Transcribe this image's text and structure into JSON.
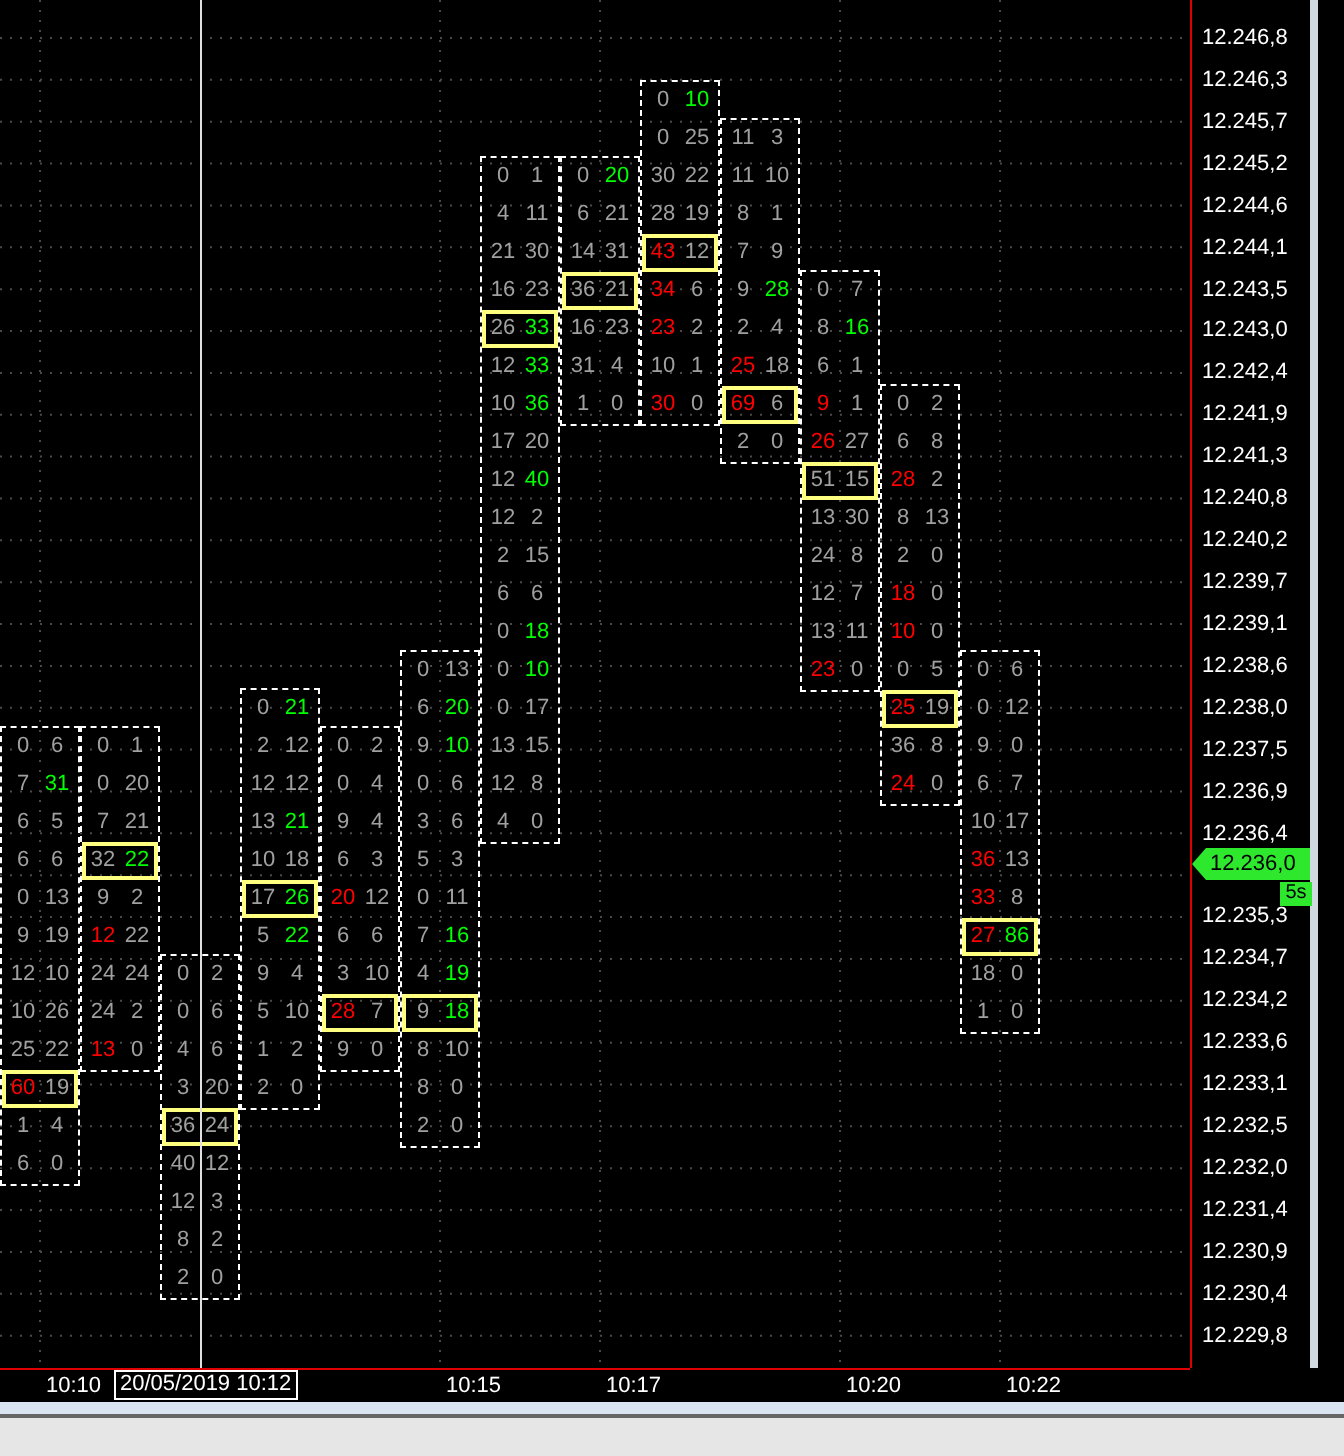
{
  "chart": {
    "columns": [
      {
        "rows": [
          {
            "bid": {
              "text": "0",
              "color": "#a0a0a0"
            },
            "ask": {
              "text": "6",
              "color": "#a0a0a0"
            },
            "poc": false
          },
          {
            "bid": {
              "text": "7",
              "color": "#a0a0a0"
            },
            "ask": {
              "text": "31",
              "color": "#00ff00"
            },
            "poc": false
          },
          {
            "bid": {
              "text": "6",
              "color": "#a0a0a0"
            },
            "ask": {
              "text": "5",
              "color": "#a0a0a0"
            },
            "poc": false
          },
          {
            "bid": {
              "text": "6",
              "color": "#a0a0a0"
            },
            "ask": {
              "text": "6",
              "color": "#a0a0a0"
            },
            "poc": false
          },
          {
            "bid": {
              "text": "0",
              "color": "#a0a0a0"
            },
            "ask": {
              "text": "13",
              "color": "#a0a0a0"
            },
            "poc": false
          },
          {
            "bid": {
              "text": "9",
              "color": "#a0a0a0"
            },
            "ask": {
              "text": "19",
              "color": "#a0a0a0"
            },
            "poc": false
          },
          {
            "bid": {
              "text": "12",
              "color": "#a0a0a0"
            },
            "ask": {
              "text": "10",
              "color": "#a0a0a0"
            },
            "poc": false
          },
          {
            "bid": {
              "text": "10",
              "color": "#a0a0a0"
            },
            "ask": {
              "text": "26",
              "color": "#a0a0a0"
            },
            "poc": false
          },
          {
            "bid": {
              "text": "25",
              "color": "#a0a0a0"
            },
            "ask": {
              "text": "22",
              "color": "#a0a0a0"
            },
            "poc": false
          },
          {
            "bid": {
              "text": "60",
              "color": "#ff0000"
            },
            "ask": {
              "text": "19",
              "color": "#a0a0a0"
            },
            "poc": true
          },
          {
            "bid": {
              "text": "1",
              "color": "#a0a0a0"
            },
            "ask": {
              "text": "4",
              "color": "#a0a0a0"
            },
            "poc": false
          },
          {
            "bid": {
              "text": "6",
              "color": "#a0a0a0"
            },
            "ask": {
              "text": "0",
              "color": "#a0a0a0"
            },
            "poc": false
          }
        ]
      },
      {
        "rows": [
          {
            "bid": {
              "text": "0",
              "color": "#a0a0a0"
            },
            "ask": {
              "text": "1",
              "color": "#a0a0a0"
            },
            "poc": false
          },
          {
            "bid": {
              "text": "0",
              "color": "#a0a0a0"
            },
            "ask": {
              "text": "20",
              "color": "#a0a0a0"
            },
            "poc": false
          },
          {
            "bid": {
              "text": "7",
              "color": "#a0a0a0"
            },
            "ask": {
              "text": "21",
              "color": "#a0a0a0"
            },
            "poc": false
          },
          {
            "bid": {
              "text": "32",
              "color": "#a0a0a0"
            },
            "ask": {
              "text": "22",
              "color": "#00ff00"
            },
            "poc": true
          },
          {
            "bid": {
              "text": "9",
              "color": "#a0a0a0"
            },
            "ask": {
              "text": "2",
              "color": "#a0a0a0"
            },
            "poc": false
          },
          {
            "bid": {
              "text": "12",
              "color": "#ff0000"
            },
            "ask": {
              "text": "22",
              "color": "#a0a0a0"
            },
            "poc": false
          },
          {
            "bid": {
              "text": "24",
              "color": "#a0a0a0"
            },
            "ask": {
              "text": "24",
              "color": "#a0a0a0"
            },
            "poc": false
          },
          {
            "bid": {
              "text": "24",
              "color": "#a0a0a0"
            },
            "ask": {
              "text": "2",
              "color": "#a0a0a0"
            },
            "poc": false
          },
          {
            "bid": {
              "text": "13",
              "color": "#ff0000"
            },
            "ask": {
              "text": "0",
              "color": "#a0a0a0"
            },
            "poc": false
          }
        ]
      },
      {
        "rows": [
          {
            "bid": {
              "text": "0",
              "color": "#a0a0a0"
            },
            "ask": {
              "text": "2",
              "color": "#a0a0a0"
            },
            "poc": false
          },
          {
            "bid": {
              "text": "0",
              "color": "#a0a0a0"
            },
            "ask": {
              "text": "6",
              "color": "#a0a0a0"
            },
            "poc": false
          },
          {
            "bid": {
              "text": "4",
              "color": "#a0a0a0"
            },
            "ask": {
              "text": "6",
              "color": "#a0a0a0"
            },
            "poc": false
          },
          {
            "bid": {
              "text": "3",
              "color": "#a0a0a0"
            },
            "ask": {
              "text": "20",
              "color": "#a0a0a0"
            },
            "poc": false
          },
          {
            "bid": {
              "text": "36",
              "color": "#a0a0a0"
            },
            "ask": {
              "text": "24",
              "color": "#a0a0a0"
            },
            "poc": true
          },
          {
            "bid": {
              "text": "40",
              "color": "#a0a0a0"
            },
            "ask": {
              "text": "12",
              "color": "#a0a0a0"
            },
            "poc": false
          },
          {
            "bid": {
              "text": "12",
              "color": "#a0a0a0"
            },
            "ask": {
              "text": "3",
              "color": "#a0a0a0"
            },
            "poc": false
          },
          {
            "bid": {
              "text": "8",
              "color": "#a0a0a0"
            },
            "ask": {
              "text": "2",
              "color": "#a0a0a0"
            },
            "poc": false
          },
          {
            "bid": {
              "text": "2",
              "color": "#a0a0a0"
            },
            "ask": {
              "text": "0",
              "color": "#a0a0a0"
            },
            "poc": false
          }
        ]
      },
      {
        "rows": [
          {
            "bid": {
              "text": "0",
              "color": "#a0a0a0"
            },
            "ask": {
              "text": "21",
              "color": "#00ff00"
            },
            "poc": false
          },
          {
            "bid": {
              "text": "2",
              "color": "#a0a0a0"
            },
            "ask": {
              "text": "12",
              "color": "#a0a0a0"
            },
            "poc": false
          },
          {
            "bid": {
              "text": "12",
              "color": "#a0a0a0"
            },
            "ask": {
              "text": "12",
              "color": "#a0a0a0"
            },
            "poc": false
          },
          {
            "bid": {
              "text": "13",
              "color": "#a0a0a0"
            },
            "ask": {
              "text": "21",
              "color": "#00ff00"
            },
            "poc": false
          },
          {
            "bid": {
              "text": "10",
              "color": "#a0a0a0"
            },
            "ask": {
              "text": "18",
              "color": "#a0a0a0"
            },
            "poc": false
          },
          {
            "bid": {
              "text": "17",
              "color": "#a0a0a0"
            },
            "ask": {
              "text": "26",
              "color": "#00ff00"
            },
            "poc": true
          },
          {
            "bid": {
              "text": "5",
              "color": "#a0a0a0"
            },
            "ask": {
              "text": "22",
              "color": "#00ff00"
            },
            "poc": false
          },
          {
            "bid": {
              "text": "9",
              "color": "#a0a0a0"
            },
            "ask": {
              "text": "4",
              "color": "#a0a0a0"
            },
            "poc": false
          },
          {
            "bid": {
              "text": "5",
              "color": "#a0a0a0"
            },
            "ask": {
              "text": "10",
              "color": "#a0a0a0"
            },
            "poc": false
          },
          {
            "bid": {
              "text": "1",
              "color": "#a0a0a0"
            },
            "ask": {
              "text": "2",
              "color": "#a0a0a0"
            },
            "poc": false
          },
          {
            "bid": {
              "text": "2",
              "color": "#a0a0a0"
            },
            "ask": {
              "text": "0",
              "color": "#a0a0a0"
            },
            "poc": false
          }
        ]
      },
      {
        "rows": [
          {
            "bid": {
              "text": "0",
              "color": "#a0a0a0"
            },
            "ask": {
              "text": "2",
              "color": "#a0a0a0"
            },
            "poc": false
          },
          {
            "bid": {
              "text": "0",
              "color": "#a0a0a0"
            },
            "ask": {
              "text": "4",
              "color": "#a0a0a0"
            },
            "poc": false
          },
          {
            "bid": {
              "text": "9",
              "color": "#a0a0a0"
            },
            "ask": {
              "text": "4",
              "color": "#a0a0a0"
            },
            "poc": false
          },
          {
            "bid": {
              "text": "6",
              "color": "#a0a0a0"
            },
            "ask": {
              "text": "3",
              "color": "#a0a0a0"
            },
            "poc": false
          },
          {
            "bid": {
              "text": "20",
              "color": "#ff0000"
            },
            "ask": {
              "text": "12",
              "color": "#a0a0a0"
            },
            "poc": false
          },
          {
            "bid": {
              "text": "6",
              "color": "#a0a0a0"
            },
            "ask": {
              "text": "6",
              "color": "#a0a0a0"
            },
            "poc": false
          },
          {
            "bid": {
              "text": "3",
              "color": "#a0a0a0"
            },
            "ask": {
              "text": "10",
              "color": "#a0a0a0"
            },
            "poc": false
          },
          {
            "bid": {
              "text": "28",
              "color": "#ff0000"
            },
            "ask": {
              "text": "7",
              "color": "#a0a0a0"
            },
            "poc": true
          },
          {
            "bid": {
              "text": "9",
              "color": "#a0a0a0"
            },
            "ask": {
              "text": "0",
              "color": "#a0a0a0"
            },
            "poc": false
          }
        ]
      },
      {
        "rows": [
          {
            "bid": {
              "text": "0",
              "color": "#a0a0a0"
            },
            "ask": {
              "text": "13",
              "color": "#a0a0a0"
            },
            "poc": false
          },
          {
            "bid": {
              "text": "6",
              "color": "#a0a0a0"
            },
            "ask": {
              "text": "20",
              "color": "#00ff00"
            },
            "poc": false
          },
          {
            "bid": {
              "text": "9",
              "color": "#a0a0a0"
            },
            "ask": {
              "text": "10",
              "color": "#00ff00"
            },
            "poc": false
          },
          {
            "bid": {
              "text": "0",
              "color": "#a0a0a0"
            },
            "ask": {
              "text": "6",
              "color": "#a0a0a0"
            },
            "poc": false
          },
          {
            "bid": {
              "text": "3",
              "color": "#a0a0a0"
            },
            "ask": {
              "text": "6",
              "color": "#a0a0a0"
            },
            "poc": false
          },
          {
            "bid": {
              "text": "5",
              "color": "#a0a0a0"
            },
            "ask": {
              "text": "3",
              "color": "#a0a0a0"
            },
            "poc": false
          },
          {
            "bid": {
              "text": "0",
              "color": "#a0a0a0"
            },
            "ask": {
              "text": "11",
              "color": "#a0a0a0"
            },
            "poc": false
          },
          {
            "bid": {
              "text": "7",
              "color": "#a0a0a0"
            },
            "ask": {
              "text": "16",
              "color": "#00ff00"
            },
            "poc": false
          },
          {
            "bid": {
              "text": "4",
              "color": "#a0a0a0"
            },
            "ask": {
              "text": "19",
              "color": "#00ff00"
            },
            "poc": false
          },
          {
            "bid": {
              "text": "9",
              "color": "#a0a0a0"
            },
            "ask": {
              "text": "18",
              "color": "#00ff00"
            },
            "poc": true
          },
          {
            "bid": {
              "text": "8",
              "color": "#a0a0a0"
            },
            "ask": {
              "text": "10",
              "color": "#a0a0a0"
            },
            "poc": false
          },
          {
            "bid": {
              "text": "8",
              "color": "#a0a0a0"
            },
            "ask": {
              "text": "0",
              "color": "#a0a0a0"
            },
            "poc": false
          },
          {
            "bid": {
              "text": "2",
              "color": "#a0a0a0"
            },
            "ask": {
              "text": "0",
              "color": "#a0a0a0"
            },
            "poc": false
          }
        ]
      },
      {
        "rows": [
          {
            "bid": {
              "text": "0",
              "color": "#a0a0a0"
            },
            "ask": {
              "text": "1",
              "color": "#a0a0a0"
            },
            "poc": false
          },
          {
            "bid": {
              "text": "4",
              "color": "#a0a0a0"
            },
            "ask": {
              "text": "11",
              "color": "#a0a0a0"
            },
            "poc": false
          },
          {
            "bid": {
              "text": "21",
              "color": "#a0a0a0"
            },
            "ask": {
              "text": "30",
              "color": "#a0a0a0"
            },
            "poc": false
          },
          {
            "bid": {
              "text": "16",
              "color": "#a0a0a0"
            },
            "ask": {
              "text": "23",
              "color": "#a0a0a0"
            },
            "poc": false
          },
          {
            "bid": {
              "text": "26",
              "color": "#a0a0a0"
            },
            "ask": {
              "text": "33",
              "color": "#00ff00"
            },
            "poc": true
          },
          {
            "bid": {
              "text": "12",
              "color": "#a0a0a0"
            },
            "ask": {
              "text": "33",
              "color": "#00ff00"
            },
            "poc": false
          },
          {
            "bid": {
              "text": "10",
              "color": "#a0a0a0"
            },
            "ask": {
              "text": "36",
              "color": "#00ff00"
            },
            "poc": false
          },
          {
            "bid": {
              "text": "17",
              "color": "#a0a0a0"
            },
            "ask": {
              "text": "20",
              "color": "#a0a0a0"
            },
            "poc": false
          },
          {
            "bid": {
              "text": "12",
              "color": "#a0a0a0"
            },
            "ask": {
              "text": "40",
              "color": "#00ff00"
            },
            "poc": false
          },
          {
            "bid": {
              "text": "12",
              "color": "#a0a0a0"
            },
            "ask": {
              "text": "2",
              "color": "#a0a0a0"
            },
            "poc": false
          },
          {
            "bid": {
              "text": "2",
              "color": "#a0a0a0"
            },
            "ask": {
              "text": "15",
              "color": "#a0a0a0"
            },
            "poc": false
          },
          {
            "bid": {
              "text": "6",
              "color": "#a0a0a0"
            },
            "ask": {
              "text": "6",
              "color": "#a0a0a0"
            },
            "poc": false
          },
          {
            "bid": {
              "text": "0",
              "color": "#a0a0a0"
            },
            "ask": {
              "text": "18",
              "color": "#00ff00"
            },
            "poc": false
          },
          {
            "bid": {
              "text": "0",
              "color": "#a0a0a0"
            },
            "ask": {
              "text": "10",
              "color": "#00ff00"
            },
            "poc": false
          },
          {
            "bid": {
              "text": "0",
              "color": "#a0a0a0"
            },
            "ask": {
              "text": "17",
              "color": "#a0a0a0"
            },
            "poc": false
          },
          {
            "bid": {
              "text": "13",
              "color": "#a0a0a0"
            },
            "ask": {
              "text": "15",
              "color": "#a0a0a0"
            },
            "poc": false
          },
          {
            "bid": {
              "text": "12",
              "color": "#a0a0a0"
            },
            "ask": {
              "text": "8",
              "color": "#a0a0a0"
            },
            "poc": false
          },
          {
            "bid": {
              "text": "4",
              "color": "#a0a0a0"
            },
            "ask": {
              "text": "0",
              "color": "#a0a0a0"
            },
            "poc": false
          }
        ]
      },
      {
        "rows": [
          {
            "bid": {
              "text": "0",
              "color": "#a0a0a0"
            },
            "ask": {
              "text": "20",
              "color": "#00ff00"
            },
            "poc": false
          },
          {
            "bid": {
              "text": "6",
              "color": "#a0a0a0"
            },
            "ask": {
              "text": "21",
              "color": "#a0a0a0"
            },
            "poc": false
          },
          {
            "bid": {
              "text": "14",
              "color": "#a0a0a0"
            },
            "ask": {
              "text": "31",
              "color": "#a0a0a0"
            },
            "poc": false
          },
          {
            "bid": {
              "text": "36",
              "color": "#a0a0a0"
            },
            "ask": {
              "text": "21",
              "color": "#a0a0a0"
            },
            "poc": true
          },
          {
            "bid": {
              "text": "16",
              "color": "#a0a0a0"
            },
            "ask": {
              "text": "23",
              "color": "#a0a0a0"
            },
            "poc": false
          },
          {
            "bid": {
              "text": "31",
              "color": "#a0a0a0"
            },
            "ask": {
              "text": "4",
              "color": "#a0a0a0"
            },
            "poc": false
          },
          {
            "bid": {
              "text": "1",
              "color": "#a0a0a0"
            },
            "ask": {
              "text": "0",
              "color": "#a0a0a0"
            },
            "poc": false
          }
        ]
      },
      {
        "rows": [
          {
            "bid": {
              "text": "0",
              "color": "#a0a0a0"
            },
            "ask": {
              "text": "10",
              "color": "#00ff00"
            },
            "poc": false
          },
          {
            "bid": {
              "text": "0",
              "color": "#a0a0a0"
            },
            "ask": {
              "text": "25",
              "color": "#a0a0a0"
            },
            "poc": false
          },
          {
            "bid": {
              "text": "30",
              "color": "#a0a0a0"
            },
            "ask": {
              "text": "22",
              "color": "#a0a0a0"
            },
            "poc": false
          },
          {
            "bid": {
              "text": "28",
              "color": "#a0a0a0"
            },
            "ask": {
              "text": "19",
              "color": "#a0a0a0"
            },
            "poc": false
          },
          {
            "bid": {
              "text": "43",
              "color": "#ff0000"
            },
            "ask": {
              "text": "12",
              "color": "#a0a0a0"
            },
            "poc": true
          },
          {
            "bid": {
              "text": "34",
              "color": "#ff0000"
            },
            "ask": {
              "text": "6",
              "color": "#a0a0a0"
            },
            "poc": false
          },
          {
            "bid": {
              "text": "23",
              "color": "#ff0000"
            },
            "ask": {
              "text": "2",
              "color": "#a0a0a0"
            },
            "poc": false
          },
          {
            "bid": {
              "text": "10",
              "color": "#a0a0a0"
            },
            "ask": {
              "text": "1",
              "color": "#a0a0a0"
            },
            "poc": false
          },
          {
            "bid": {
              "text": "30",
              "color": "#ff0000"
            },
            "ask": {
              "text": "0",
              "color": "#a0a0a0"
            },
            "poc": false
          }
        ]
      },
      {
        "rows": [
          {
            "bid": {
              "text": "11",
              "color": "#a0a0a0"
            },
            "ask": {
              "text": "3",
              "color": "#a0a0a0"
            },
            "poc": false
          },
          {
            "bid": {
              "text": "11",
              "color": "#a0a0a0"
            },
            "ask": {
              "text": "10",
              "color": "#a0a0a0"
            },
            "poc": false
          },
          {
            "bid": {
              "text": "8",
              "color": "#a0a0a0"
            },
            "ask": {
              "text": "1",
              "color": "#a0a0a0"
            },
            "poc": false
          },
          {
            "bid": {
              "text": "7",
              "color": "#a0a0a0"
            },
            "ask": {
              "text": "9",
              "color": "#a0a0a0"
            },
            "poc": false
          },
          {
            "bid": {
              "text": "9",
              "color": "#a0a0a0"
            },
            "ask": {
              "text": "28",
              "color": "#00ff00"
            },
            "poc": false
          },
          {
            "bid": {
              "text": "2",
              "color": "#a0a0a0"
            },
            "ask": {
              "text": "4",
              "color": "#a0a0a0"
            },
            "poc": false
          },
          {
            "bid": {
              "text": "25",
              "color": "#ff0000"
            },
            "ask": {
              "text": "18",
              "color": "#a0a0a0"
            },
            "poc": false
          },
          {
            "bid": {
              "text": "69",
              "color": "#ff0000"
            },
            "ask": {
              "text": "6",
              "color": "#a0a0a0"
            },
            "poc": true
          },
          {
            "bid": {
              "text": "2",
              "color": "#a0a0a0"
            },
            "ask": {
              "text": "0",
              "color": "#a0a0a0"
            },
            "poc": false
          }
        ]
      },
      {
        "rows": [
          {
            "bid": {
              "text": "0",
              "color": "#a0a0a0"
            },
            "ask": {
              "text": "7",
              "color": "#a0a0a0"
            },
            "poc": false
          },
          {
            "bid": {
              "text": "8",
              "color": "#a0a0a0"
            },
            "ask": {
              "text": "16",
              "color": "#00ff00"
            },
            "poc": false
          },
          {
            "bid": {
              "text": "6",
              "color": "#a0a0a0"
            },
            "ask": {
              "text": "1",
              "color": "#a0a0a0"
            },
            "poc": false
          },
          {
            "bid": {
              "text": "9",
              "color": "#ff0000"
            },
            "ask": {
              "text": "1",
              "color": "#a0a0a0"
            },
            "poc": false
          },
          {
            "bid": {
              "text": "26",
              "color": "#ff0000"
            },
            "ask": {
              "text": "27",
              "color": "#a0a0a0"
            },
            "poc": false
          },
          {
            "bid": {
              "text": "51",
              "color": "#a0a0a0"
            },
            "ask": {
              "text": "15",
              "color": "#a0a0a0"
            },
            "poc": true
          },
          {
            "bid": {
              "text": "13",
              "color": "#a0a0a0"
            },
            "ask": {
              "text": "30",
              "color": "#a0a0a0"
            },
            "poc": false
          },
          {
            "bid": {
              "text": "24",
              "color": "#a0a0a0"
            },
            "ask": {
              "text": "8",
              "color": "#a0a0a0"
            },
            "poc": false
          },
          {
            "bid": {
              "text": "12",
              "color": "#a0a0a0"
            },
            "ask": {
              "text": "7",
              "color": "#a0a0a0"
            },
            "poc": false
          },
          {
            "bid": {
              "text": "13",
              "color": "#a0a0a0"
            },
            "ask": {
              "text": "11",
              "color": "#a0a0a0"
            },
            "poc": false
          },
          {
            "bid": {
              "text": "23",
              "color": "#ff0000"
            },
            "ask": {
              "text": "0",
              "color": "#a0a0a0"
            },
            "poc": false
          }
        ]
      },
      {
        "rows": [
          {
            "bid": {
              "text": "0",
              "color": "#a0a0a0"
            },
            "ask": {
              "text": "2",
              "color": "#a0a0a0"
            },
            "poc": false
          },
          {
            "bid": {
              "text": "6",
              "color": "#a0a0a0"
            },
            "ask": {
              "text": "8",
              "color": "#a0a0a0"
            },
            "poc": false
          },
          {
            "bid": {
              "text": "28",
              "color": "#ff0000"
            },
            "ask": {
              "text": "2",
              "color": "#a0a0a0"
            },
            "poc": false
          },
          {
            "bid": {
              "text": "8",
              "color": "#a0a0a0"
            },
            "ask": {
              "text": "13",
              "color": "#a0a0a0"
            },
            "poc": false
          },
          {
            "bid": {
              "text": "2",
              "color": "#a0a0a0"
            },
            "ask": {
              "text": "0",
              "color": "#a0a0a0"
            },
            "poc": false
          },
          {
            "bid": {
              "text": "18",
              "color": "#ff0000"
            },
            "ask": {
              "text": "0",
              "color": "#a0a0a0"
            },
            "poc": false
          },
          {
            "bid": {
              "text": "10",
              "color": "#ff0000"
            },
            "ask": {
              "text": "0",
              "color": "#a0a0a0"
            },
            "poc": false
          },
          {
            "bid": {
              "text": "0",
              "color": "#a0a0a0"
            },
            "ask": {
              "text": "5",
              "color": "#a0a0a0"
            },
            "poc": false
          },
          {
            "bid": {
              "text": "25",
              "color": "#ff0000"
            },
            "ask": {
              "text": "19",
              "color": "#a0a0a0"
            },
            "poc": true
          },
          {
            "bid": {
              "text": "36",
              "color": "#a0a0a0"
            },
            "ask": {
              "text": "8",
              "color": "#a0a0a0"
            },
            "poc": false
          },
          {
            "bid": {
              "text": "24",
              "color": "#ff0000"
            },
            "ask": {
              "text": "0",
              "color": "#a0a0a0"
            },
            "poc": false
          }
        ]
      },
      {
        "rows": [
          {
            "bid": {
              "text": "0",
              "color": "#a0a0a0"
            },
            "ask": {
              "text": "6",
              "color": "#a0a0a0"
            },
            "poc": false
          },
          {
            "bid": {
              "text": "0",
              "color": "#a0a0a0"
            },
            "ask": {
              "text": "12",
              "color": "#a0a0a0"
            },
            "poc": false
          },
          {
            "bid": {
              "text": "9",
              "color": "#a0a0a0"
            },
            "ask": {
              "text": "0",
              "color": "#a0a0a0"
            },
            "poc": false
          },
          {
            "bid": {
              "text": "6",
              "color": "#a0a0a0"
            },
            "ask": {
              "text": "7",
              "color": "#a0a0a0"
            },
            "poc": false
          },
          {
            "bid": {
              "text": "10",
              "color": "#a0a0a0"
            },
            "ask": {
              "text": "17",
              "color": "#a0a0a0"
            },
            "poc": false
          },
          {
            "bid": {
              "text": "36",
              "color": "#ff0000"
            },
            "ask": {
              "text": "13",
              "color": "#a0a0a0"
            },
            "poc": false
          },
          {
            "bid": {
              "text": "33",
              "color": "#ff0000"
            },
            "ask": {
              "text": "8",
              "color": "#a0a0a0"
            },
            "poc": false
          },
          {
            "bid": {
              "text": "27",
              "color": "#ff0000"
            },
            "ask": {
              "text": "86",
              "color": "#00ff00"
            },
            "poc": true
          },
          {
            "bid": {
              "text": "18",
              "color": "#a0a0a0"
            },
            "ask": {
              "text": "0",
              "color": "#a0a0a0"
            },
            "poc": false
          },
          {
            "bid": {
              "text": "1",
              "color": "#a0a0a0"
            },
            "ask": {
              "text": "0",
              "color": "#a0a0a0"
            },
            "poc": false
          }
        ]
      }
    ]
  },
  "price_axis": {
    "labels": [
      "12.246,8",
      "12.246,3",
      "12.245,7",
      "12.245,2",
      "12.244,6",
      "12.244,1",
      "12.243,5",
      "12.243,0",
      "12.242,4",
      "12.241,9",
      "12.241,3",
      "12.240,8",
      "12.240,2",
      "12.239,7",
      "12.239,1",
      "12.238,6",
      "12.238,0",
      "12.237,5",
      "12.236,9",
      "12.236,4",
      "12.235,3",
      "12.234,7",
      "12.234,2",
      "12.233,6",
      "12.233,1",
      "12.232,5",
      "12.232,0",
      "12.231,4",
      "12.230,9",
      "12.230,4",
      "12.229,8"
    ],
    "current_price": "12.236,0",
    "timer": "5s"
  },
  "time_axis": {
    "labels": [
      "10:10",
      "10:15",
      "10:17",
      "10:20",
      "10:22"
    ],
    "cursor_label": "20/05/2019 10:12"
  }
}
